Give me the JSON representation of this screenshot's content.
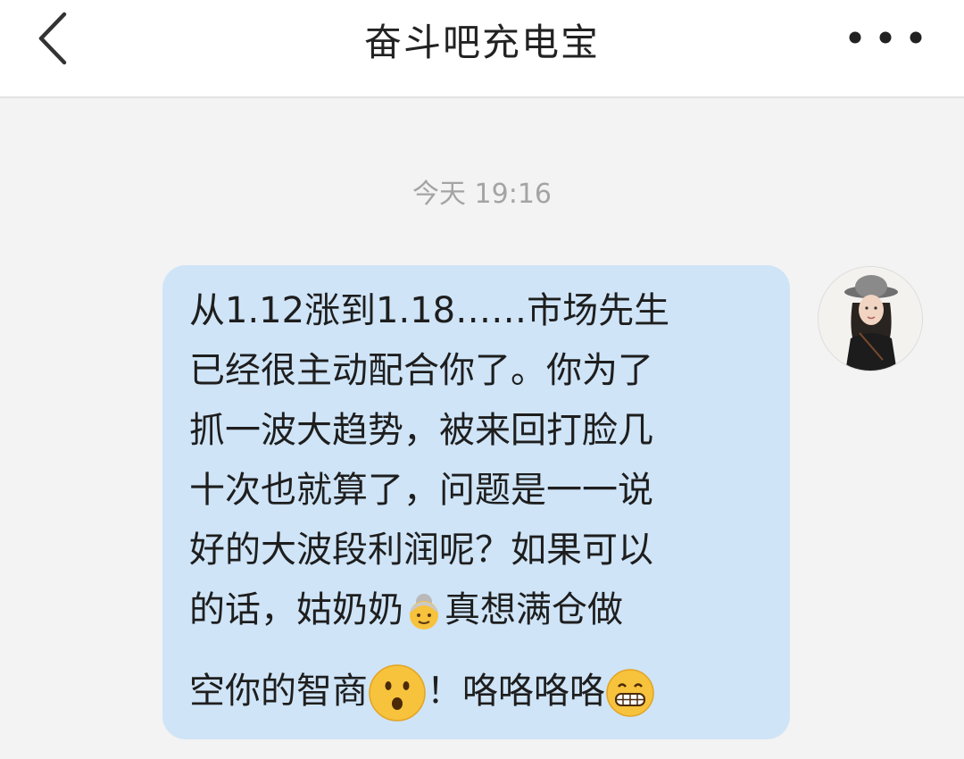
{
  "header": {
    "title": "奋斗吧充电宝"
  },
  "chat": {
    "timestamp": "今天 19:16",
    "message": {
      "line1": "从1.12涨到1.18……市场先生",
      "line2": "已经很主动配合你了。你为了",
      "line3": "抓一波大趋势，被来回打脸几",
      "line4": "十次也就算了，问题是一一说",
      "line5": "好的大波段利润呢？如果可以",
      "line6a": "的话，姑奶奶",
      "line6b": "真想满仓做",
      "line7a": "空你的智商",
      "line7b": "！咯咯咯咯",
      "emojis": [
        "old-woman-emoji",
        "frowning-face-emoji",
        "grinning-face-emoji"
      ]
    }
  },
  "colors": {
    "header_bg": "#ffffff",
    "page_bg": "#f3f3f3",
    "bubble_bg": "#cfe4f7",
    "timestamp_color": "#a4a4a4",
    "emoji_yellow": "#f7c23c"
  }
}
